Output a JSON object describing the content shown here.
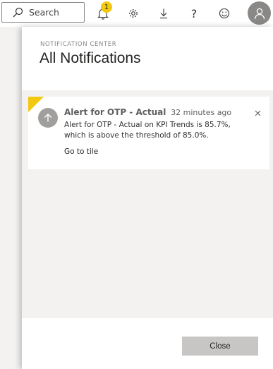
{
  "topbar": {
    "search": {
      "placeholder": "Search",
      "icon": "search-icon"
    },
    "notifications": {
      "icon": "bell-icon",
      "badge_count": "1"
    },
    "settings": {
      "icon": "gear-icon"
    },
    "download": {
      "icon": "download-icon"
    },
    "help": {
      "icon": "question-icon",
      "glyph": "?"
    },
    "feedback": {
      "icon": "smiley-icon"
    },
    "account": {
      "icon": "person-icon"
    }
  },
  "panel": {
    "eyebrow": "NOTIFICATION CENTER",
    "title": "All Notifications",
    "notifications": [
      {
        "title": "Alert for OTP - Actual",
        "time": "32 minutes ago",
        "body": "Alert for OTP - Actual on KPI Trends is 85.7%, which is above the threshold of 85.0%.",
        "link": "Go to tile",
        "icon": "arrow-up-icon",
        "accent": "#f2c811"
      }
    ],
    "close_label": "Close"
  },
  "colors": {
    "accent": "#f2c811",
    "panel_bg": "#f3f2f1",
    "button_bg": "#c8c6c4"
  }
}
